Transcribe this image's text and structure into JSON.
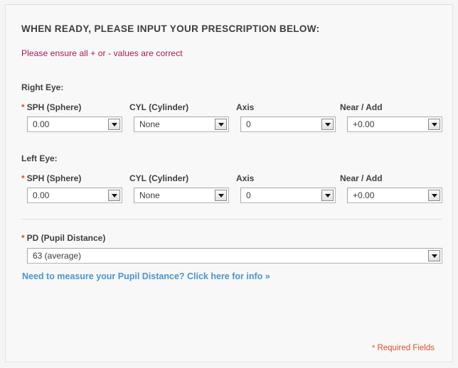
{
  "form": {
    "heading": "WHEN READY, PLEASE INPUT YOUR PRESCRIPTION BELOW:",
    "warning_note": "Please ensure all + or - values are correct",
    "required_marker": "*",
    "required_fields_star": "*",
    "required_fields_label": " Required Fields"
  },
  "right_eye": {
    "section_label": "Right Eye:",
    "fields": [
      {
        "label": "SPH (Sphere)",
        "value": "0.00",
        "required": true
      },
      {
        "label": "CYL (Cylinder)",
        "value": "None",
        "required": false
      },
      {
        "label": "Axis",
        "value": "0",
        "required": false
      },
      {
        "label": "Near / Add",
        "value": "+0.00",
        "required": false
      }
    ]
  },
  "left_eye": {
    "section_label": "Left Eye:",
    "fields": [
      {
        "label": "SPH (Sphere)",
        "value": "0.00",
        "required": true
      },
      {
        "label": "CYL (Cylinder)",
        "value": "None",
        "required": false
      },
      {
        "label": "Axis",
        "value": "0",
        "required": false
      },
      {
        "label": "Near / Add",
        "value": "+0.00",
        "required": false
      }
    ]
  },
  "pd": {
    "label": "PD (Pupil Distance)",
    "value": "63 (average)",
    "required": true,
    "link_text": "Need to measure your Pupil Distance? Click here for info »"
  },
  "colors": {
    "accent_warning": "#a3185c",
    "required_star": "#d9502e",
    "link": "#4d95c9",
    "text": "#3f3f3f",
    "panel_bg": "#f7f8f7",
    "page_bg": "#f4f5f4"
  }
}
